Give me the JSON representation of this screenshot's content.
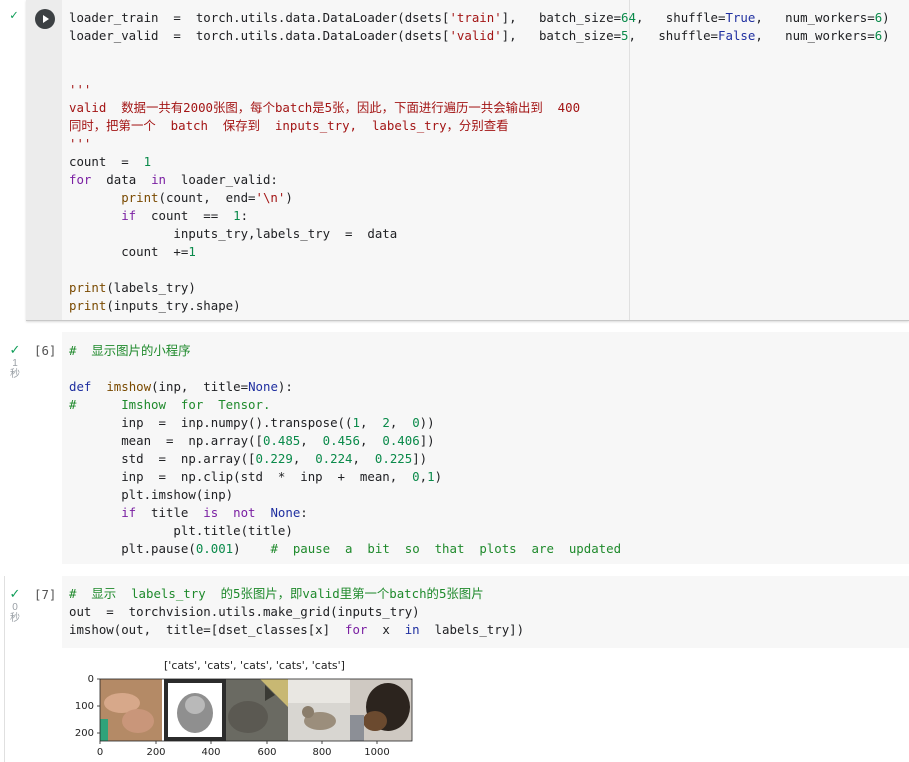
{
  "cell1": {
    "lines": [
      [
        "loader_train  =  torch.utils.data.DataLoader(dsets[",
        {
          "s": "'train'",
          "c": "str"
        },
        "],   batch_size=",
        {
          "s": "64",
          "c": "num"
        },
        ",   shuffle=",
        {
          "s": "True",
          "c": "kwb"
        },
        ",   num_workers=",
        {
          "s": "6",
          "c": "num"
        },
        ")"
      ],
      [
        "loader_valid  =  torch.utils.data.DataLoader(dsets[",
        {
          "s": "'valid'",
          "c": "str"
        },
        "],   batch_size=",
        {
          "s": "5",
          "c": "num"
        },
        ",   shuffle=",
        {
          "s": "False",
          "c": "kwb"
        },
        ",   num_workers=",
        {
          "s": "6",
          "c": "num"
        },
        ")"
      ],
      [
        ""
      ],
      [
        ""
      ],
      [
        {
          "s": "'''",
          "c": "str"
        }
      ],
      [
        {
          "s": "valid  数据一共有2000张图，每个batch是5张，因此，下面进行遍历一共会输出到  400",
          "c": "str"
        }
      ],
      [
        {
          "s": "同时，把第一个  batch  保存到  inputs_try,  labels_try，分别查看",
          "c": "str"
        }
      ],
      [
        {
          "s": "'''",
          "c": "str"
        }
      ],
      [
        "count  =  ",
        {
          "s": "1",
          "c": "num"
        }
      ],
      [
        {
          "s": "for",
          "c": "kw"
        },
        "  data  ",
        {
          "s": "in",
          "c": "kw"
        },
        "  loader_valid:"
      ],
      [
        "       ",
        {
          "s": "print",
          "c": "fn"
        },
        "(count,  end=",
        {
          "s": "'\\n'",
          "c": "str"
        },
        ")"
      ],
      [
        "       ",
        {
          "s": "if",
          "c": "kw"
        },
        "  count  ==  ",
        {
          "s": "1",
          "c": "num"
        },
        ":"
      ],
      [
        "              inputs_try,labels_try  =  data"
      ],
      [
        "       count  +=",
        {
          "s": "1",
          "c": "num"
        }
      ],
      [
        ""
      ],
      [
        {
          "s": "print",
          "c": "fn"
        },
        "(labels_try)"
      ],
      [
        {
          "s": "print",
          "c": "fn"
        },
        "(inputs_try.shape)"
      ]
    ]
  },
  "cell2": {
    "prompt": "[6]",
    "exec_time": "1",
    "exec_unit": "秒",
    "lines": [
      [
        {
          "s": "#  显示图片的小程序",
          "c": "cmt"
        }
      ],
      [
        ""
      ],
      [
        {
          "s": "def",
          "c": "kwb"
        },
        "  ",
        {
          "s": "imshow",
          "c": "fn"
        },
        "(inp,  title=",
        {
          "s": "None",
          "c": "kwb"
        },
        "):"
      ],
      [
        {
          "s": "#      Imshow  for  Tensor.",
          "c": "cmt"
        }
      ],
      [
        "       inp  =  inp.numpy().transpose((",
        {
          "s": "1",
          "c": "num"
        },
        ",  ",
        {
          "s": "2",
          "c": "num"
        },
        ",  ",
        {
          "s": "0",
          "c": "num"
        },
        "))"
      ],
      [
        "       mean  =  np.array([",
        {
          "s": "0.485",
          "c": "num"
        },
        ",  ",
        {
          "s": "0.456",
          "c": "num"
        },
        ",  ",
        {
          "s": "0.406",
          "c": "num"
        },
        "])"
      ],
      [
        "       std  =  np.array([",
        {
          "s": "0.229",
          "c": "num"
        },
        ",  ",
        {
          "s": "0.224",
          "c": "num"
        },
        ",  ",
        {
          "s": "0.225",
          "c": "num"
        },
        "])"
      ],
      [
        "       inp  =  np.clip(std  *  inp  +  mean,  ",
        {
          "s": "0",
          "c": "num"
        },
        ",",
        {
          "s": "1",
          "c": "num"
        },
        ")"
      ],
      [
        "       plt.imshow(inp)"
      ],
      [
        "       ",
        {
          "s": "if",
          "c": "kw"
        },
        "  title  ",
        {
          "s": "is",
          "c": "kw"
        },
        "  ",
        {
          "s": "not",
          "c": "kw"
        },
        "  ",
        {
          "s": "None",
          "c": "kwb"
        },
        ":"
      ],
      [
        "              plt.title(title)"
      ],
      [
        "       plt.pause(",
        {
          "s": "0.001",
          "c": "num"
        },
        ")    ",
        {
          "s": "#  pause  a  bit  so  that  plots  are  updated",
          "c": "cmt"
        }
      ]
    ]
  },
  "cell3": {
    "prompt": "[7]",
    "exec_time": "0",
    "exec_unit": "秒",
    "lines": [
      [
        {
          "s": "#  显示  labels_try  的5张图片，即valid里第一个batch的5张图片",
          "c": "cmt"
        }
      ],
      [
        "out  =  torchvision.utils.make_grid(inputs_try)"
      ],
      [
        "imshow(out,  title=[dset_classes[x]  ",
        {
          "s": "for",
          "c": "kw"
        },
        "  x  ",
        {
          "s": "in",
          "c": "kwb"
        },
        "  labels_try])"
      ]
    ]
  },
  "output": {
    "plot_title": "['cats', 'cats', 'cats', 'cats', 'cats']",
    "y_ticks": [
      "0",
      "100",
      "200"
    ],
    "x_ticks": [
      "0",
      "200",
      "400",
      "600",
      "800",
      "1000"
    ]
  },
  "colors": {
    "cell_bg": "#f7f7f7",
    "run_button": "#3c4043",
    "check": "#0f9d58"
  }
}
